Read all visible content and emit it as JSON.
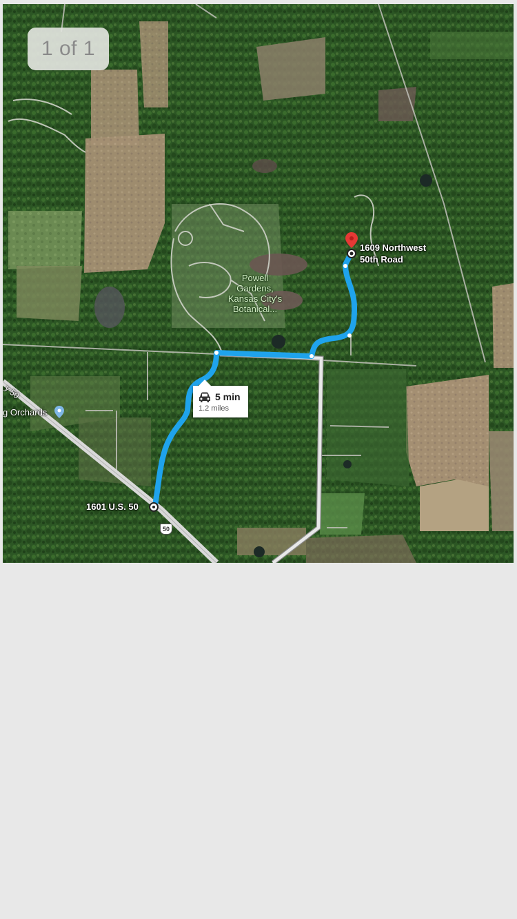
{
  "viewer": {
    "page_counter": "1 of 1"
  },
  "map": {
    "map_type": "satellite",
    "destination": {
      "label_line1": "1609 Northwest",
      "label_line2": "50th Road"
    },
    "origin": {
      "label": "1601 U.S. 50"
    },
    "poi": {
      "line1": "Powell",
      "line2": "Gardens,",
      "line3": "Kansas City's",
      "line4": "Botanical..."
    },
    "partial_place": {
      "label": "g Orchards"
    },
    "highway_shield": "50",
    "highway_fragment": "y 50",
    "route": {
      "time": "5 min",
      "distance": "1.2 miles",
      "color": "#1fa3ec"
    },
    "icons": [
      "car-icon",
      "destination-pin-icon",
      "place-pin-icon"
    ]
  }
}
